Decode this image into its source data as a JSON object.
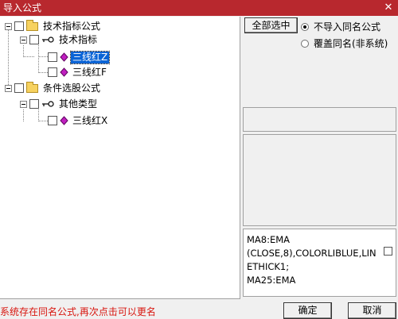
{
  "window": {
    "title": "导入公式"
  },
  "tree": {
    "root1": {
      "label": "技术指标公式"
    },
    "group1": {
      "label": "技术指标"
    },
    "item1": {
      "label": "三线红Z"
    },
    "item2": {
      "label": "三线红F"
    },
    "root2": {
      "label": "条件选股公式"
    },
    "group2": {
      "label": "其他类型"
    },
    "item3": {
      "label": "三线红X"
    }
  },
  "options": {
    "select_all": "全部选中",
    "radio_no_import": "不导入同名公式",
    "radio_overwrite": "覆盖同名(非系统)"
  },
  "code": {
    "lines": [
      "MA8:EMA",
      "(CLOSE,8),COLORLIBLUE,LIN",
      "ETHICK1;",
      "MA25:EMA"
    ]
  },
  "status": {
    "message": "系统存在同名公式,再次点击可以更名"
  },
  "buttons": {
    "ok": "确定",
    "cancel": "取消"
  },
  "colors": {
    "titlebar": "#b8282e",
    "selection": "#0a64d6",
    "status_text": "#d8160f"
  }
}
